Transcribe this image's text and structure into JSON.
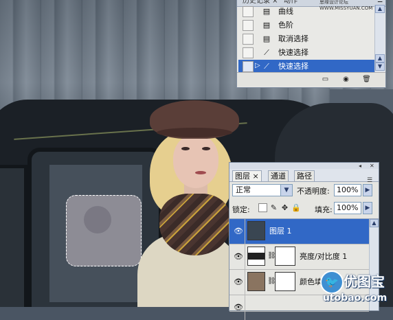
{
  "history_panel": {
    "tabs": [
      "历史记录 ×",
      "动作"
    ],
    "watermark": "思缘设计论坛 WWW.MISSYUAN.COM",
    "items": [
      {
        "icon": "document-icon",
        "label": "曲线",
        "active": false
      },
      {
        "icon": "document-icon",
        "label": "色阶",
        "active": false
      },
      {
        "icon": "document-icon",
        "label": "取消选择",
        "active": false
      },
      {
        "icon": "quick-select-icon",
        "label": "快速选择",
        "active": false
      },
      {
        "icon": "quick-select-icon",
        "label": "快速选择",
        "active": true
      }
    ],
    "footer_buttons": [
      "new-document-icon",
      "snapshot-icon",
      "trash-icon"
    ]
  },
  "layers_panel": {
    "tabs": [
      {
        "label": "图层 ×",
        "active": true
      },
      {
        "label": "通道",
        "active": false
      },
      {
        "label": "路径",
        "active": false
      }
    ],
    "blend_mode": "正常",
    "opacity_label": "不透明度:",
    "opacity_value": "100%",
    "lock_label": "锁定:",
    "fill_label": "填充:",
    "fill_value": "100%",
    "layers": [
      {
        "name": "图层 1",
        "active": true,
        "thumb_color": "#3a4652",
        "has_mask": false
      },
      {
        "name": "亮度/对比度 1",
        "active": false,
        "thumb_color": "#2a2a2a",
        "has_mask": true
      },
      {
        "name": "颜色填充",
        "active": false,
        "thumb_color": "#8a7460",
        "has_mask": true
      }
    ]
  },
  "watermark": {
    "brand_cn": "优图宝",
    "brand_en": "utobao.com"
  },
  "colors": {
    "selection_blue": "#3168c6",
    "panel_bg": "#e6e6e2"
  }
}
